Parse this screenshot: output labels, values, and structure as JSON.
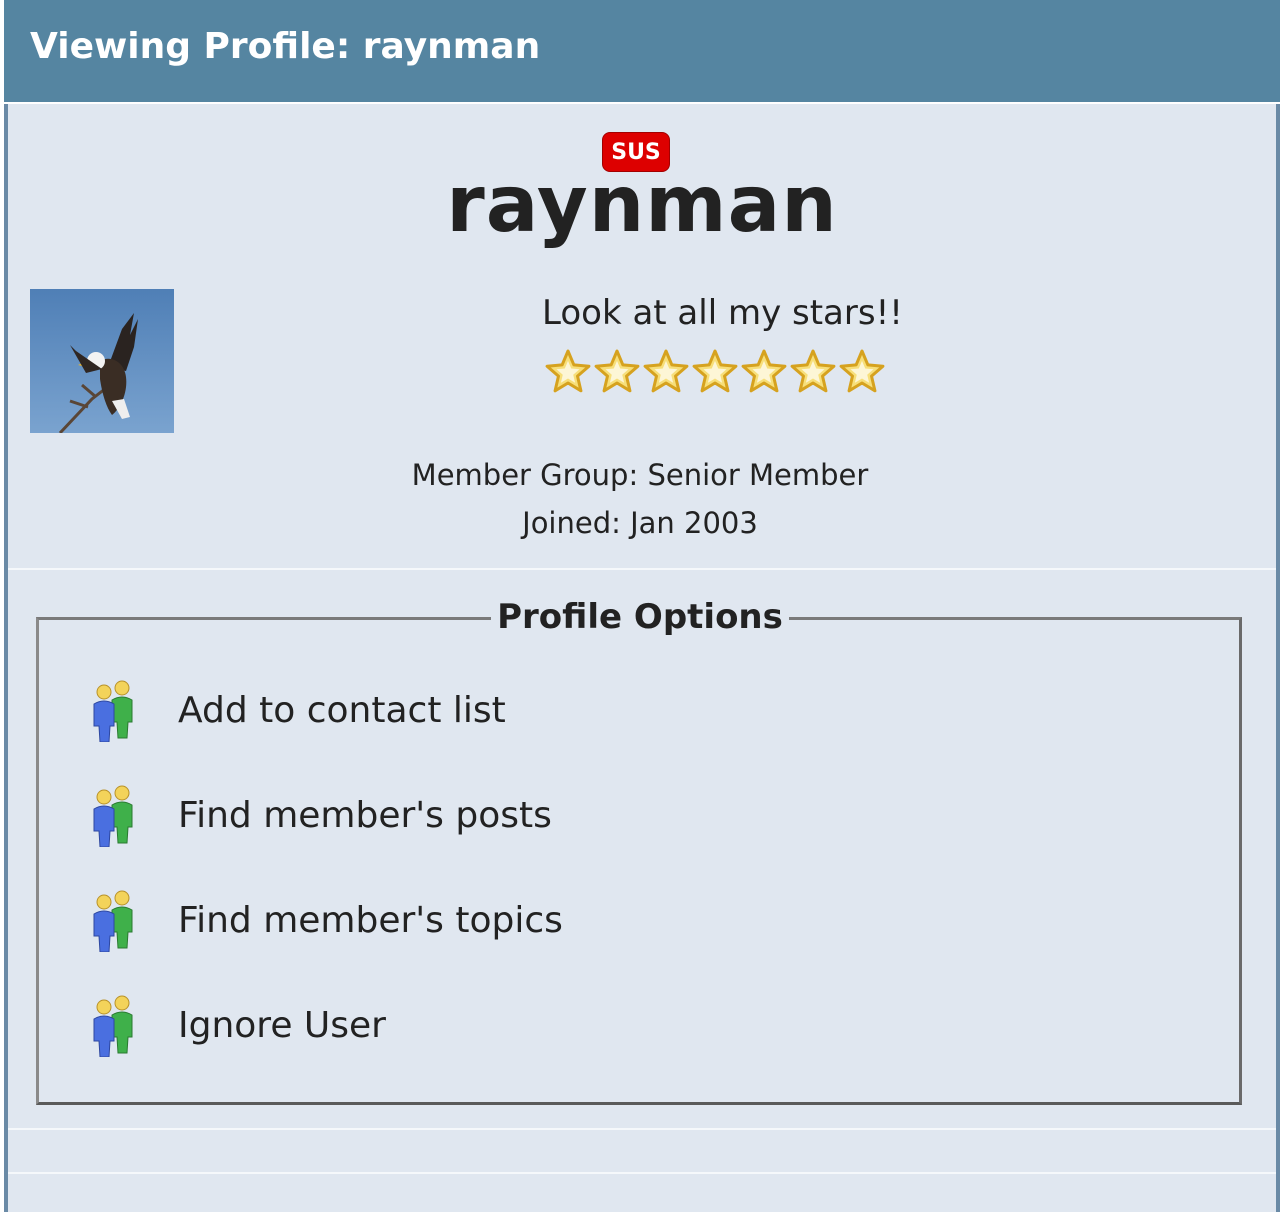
{
  "header": {
    "title": "Viewing Profile: raynman"
  },
  "profile": {
    "badge": "SUS",
    "username": "raynman",
    "tagline": "Look at all my stars!!",
    "star_count": 7,
    "member_group": "Member Group: Senior Member",
    "joined": "Joined: Jan 2003",
    "avatar_icon": "eagle-avatar"
  },
  "options": {
    "legend": "Profile Options",
    "items": [
      {
        "label": "Add to contact list",
        "icon": "members-icon"
      },
      {
        "label": "Find member's posts",
        "icon": "members-icon"
      },
      {
        "label": "Find member's topics",
        "icon": "members-icon"
      },
      {
        "label": "Ignore User",
        "icon": "members-icon"
      }
    ]
  },
  "colors": {
    "header_bg": "#5585a1",
    "panel_bg": "#e0e7f0",
    "badge_bg": "#dd0000",
    "star_fill": "#f7df7a"
  }
}
